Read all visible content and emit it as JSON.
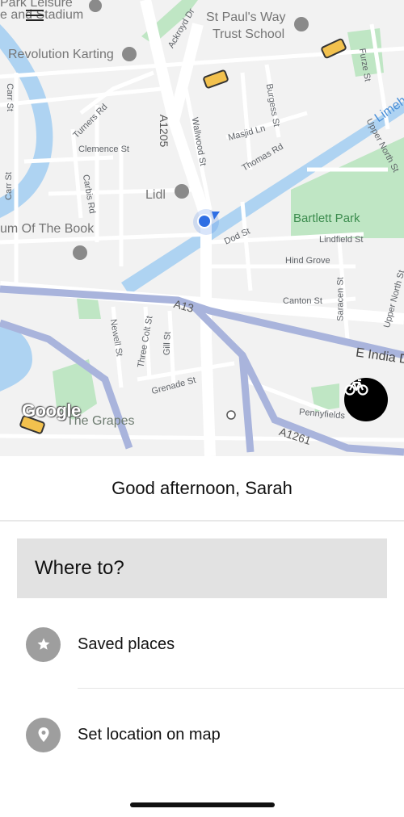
{
  "map": {
    "labels": {
      "leisure_stadium": "e and Stadium",
      "park_leisure": "Park Leisure",
      "st_pauls": "St Paul's Way",
      "trust_school": "Trust School",
      "revolution_karting": "Revolution Karting",
      "ackroyd_dr": "Ackroyd Dr",
      "furze_st": "Furze St",
      "limehouse": "Limeh",
      "carr_st": "Carr St",
      "turners_rd": "Turners Rd",
      "clemence_st": "Clemence St",
      "a1205": "A1205",
      "wallwood_st": "Wallwood St",
      "masjid_ln": "Masjid Ln",
      "burgess_st": "Burgess St",
      "thomas_rd": "Thomas Rd",
      "upper_north_st": "Upper North St",
      "upper_north_st_2": "Upper North St",
      "carr_st_2": "Carr St",
      "carbis_rd": "Carbis Rd",
      "lidl": "Lidl",
      "museum_book": "um Of The Book",
      "bartlett_park": "Bartlett Park",
      "dod_st": "Dod St",
      "lindfield_st": "Lindfield St",
      "hind_grove": "Hind Grove",
      "canton_st": "Canton St",
      "saracen_st": "Saracen St",
      "a13": "A13",
      "newell_st": "Newell St",
      "three_colt_st": "Three Colt St",
      "gill_st": "Gill St",
      "e_india_d": "E India D",
      "grenade_st": "Grenade St",
      "pennyfields": "Pennyfields",
      "the_grapes": "The Grapes",
      "a1261": "A1261",
      "google": "Google"
    },
    "colors": {
      "land": "#f2f2f2",
      "road": "#ffffff",
      "park": "#bfe6c4",
      "water": "#aed3f2",
      "major_road": "#a9b4dc",
      "location_dot": "#2f6fe4"
    },
    "icons": {
      "menu": "hamburger-menu-icon",
      "bike": "bicycle-icon",
      "location": "current-location-icon",
      "poi": "map-pin-icon"
    }
  },
  "sheet": {
    "greeting": "Good afternoon, Sarah",
    "where_to": "Where to?",
    "options": [
      {
        "label": "Saved places",
        "icon": "star-icon"
      },
      {
        "label": "Set location on map",
        "icon": "location-pin-icon"
      }
    ]
  }
}
